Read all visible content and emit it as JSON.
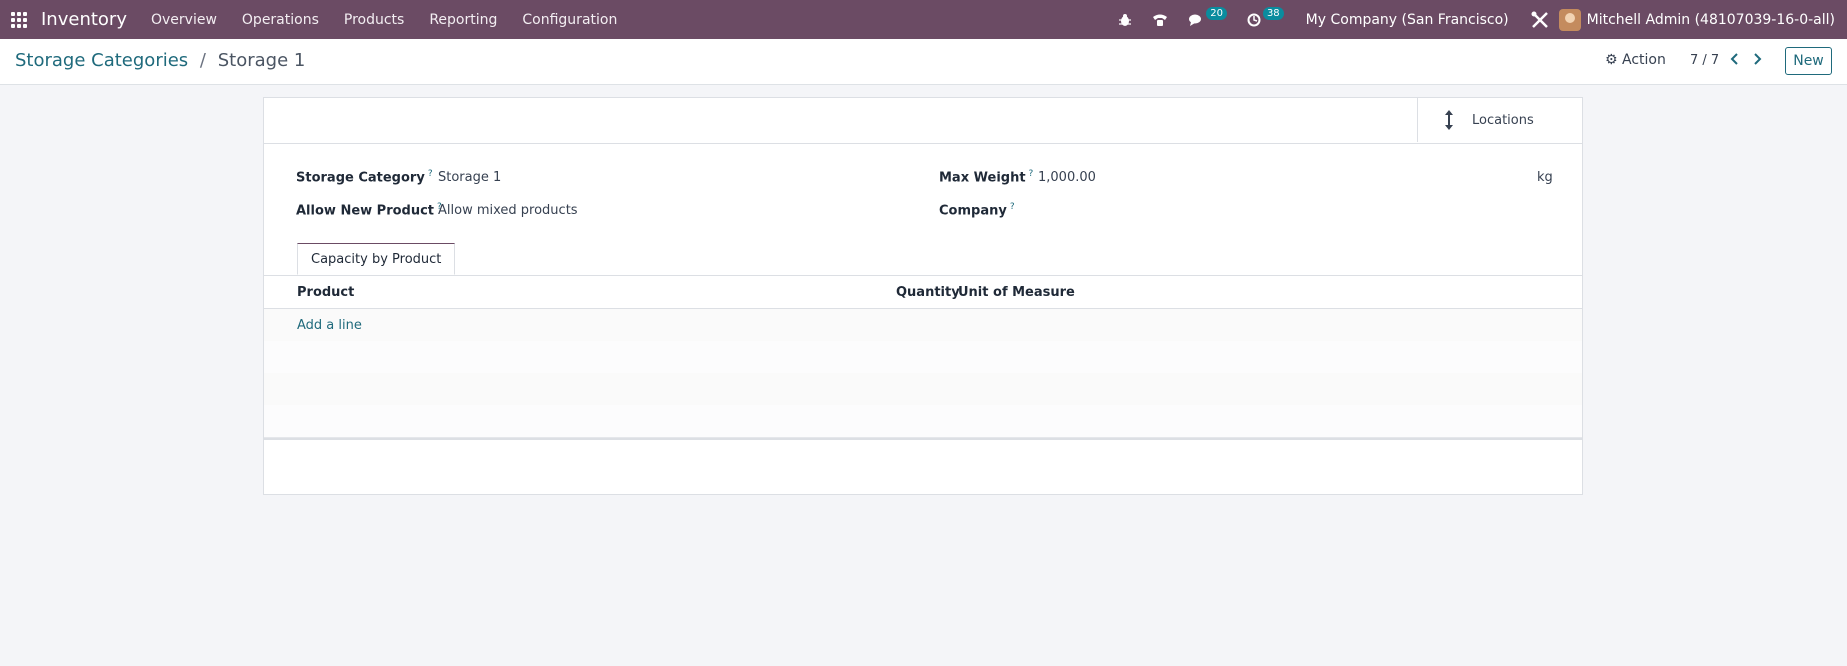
{
  "navbar": {
    "app_name": "Inventory",
    "menu": [
      "Overview",
      "Operations",
      "Products",
      "Reporting",
      "Configuration"
    ],
    "messages_count": "20",
    "activities_count": "38",
    "company": "My Company (San Francisco)",
    "user": "Mitchell Admin (48107039-16-0-all)"
  },
  "control": {
    "breadcrumb_parent": "Storage Categories",
    "breadcrumb_sep": "/",
    "breadcrumb_current": "Storage 1",
    "action_label": "Action",
    "pager": "7 / 7",
    "new_label": "New"
  },
  "form": {
    "stat_button_label": "Locations",
    "fields": {
      "storage_category_label": "Storage Category",
      "storage_category_value": "Storage 1",
      "allow_new_product_label": "Allow New Product",
      "allow_new_product_value": "Allow mixed products",
      "max_weight_label": "Max Weight",
      "max_weight_value": "1,000.00",
      "max_weight_unit": "kg",
      "company_label": "Company",
      "help_mark": "?"
    },
    "tab_label": "Capacity by Product",
    "table": {
      "columns": [
        "Product",
        "Quantity",
        "Unit of Measure"
      ],
      "add_line": "Add a line"
    }
  },
  "icons": {
    "apps": "apps-grid-icon",
    "bug": "bug-icon",
    "phone": "phone-icon",
    "chat": "chat-icon",
    "activity": "clock-icon",
    "settings": "tools-icon",
    "action": "gear-icon",
    "locations": "vertical-arrows-icon"
  },
  "colors": {
    "navbar": "#6b4b64",
    "accent": "#1f6a7c",
    "badge": "#0a8c9e"
  }
}
